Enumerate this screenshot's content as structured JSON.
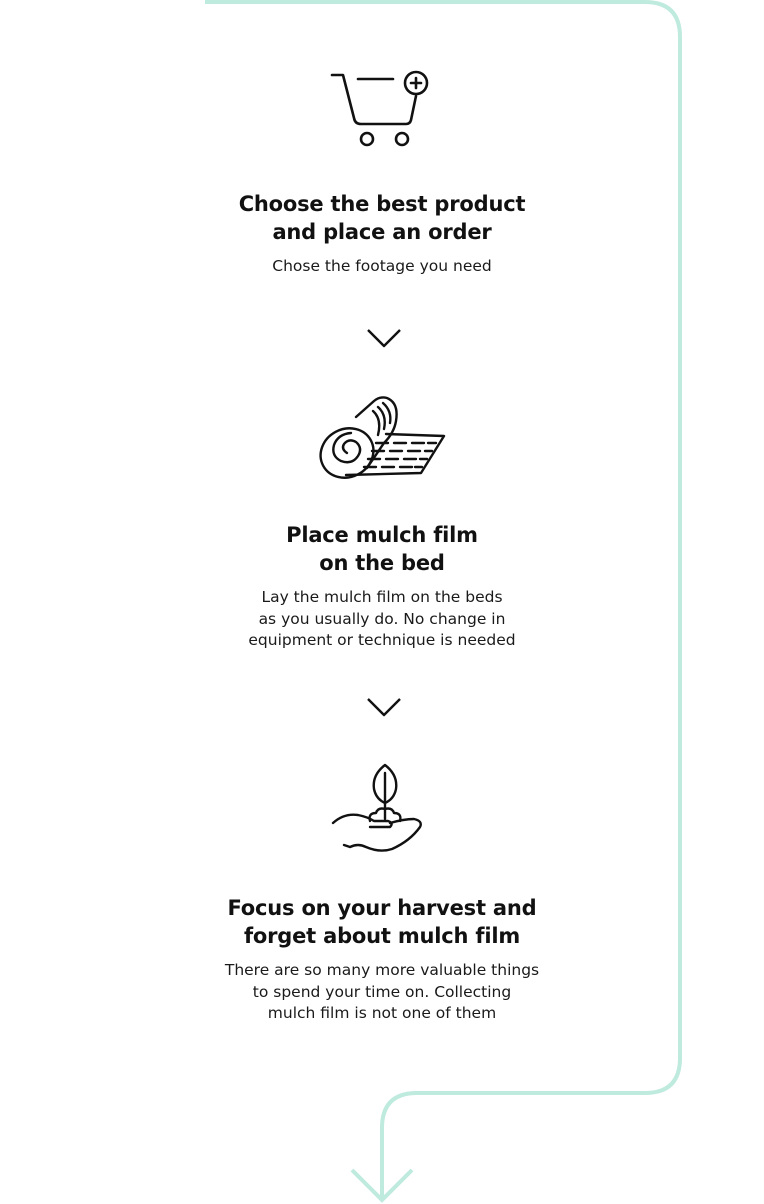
{
  "colors": {
    "flow_line": "#bfeade",
    "icon_stroke": "#111111",
    "text": "#111111"
  },
  "steps": [
    {
      "icon": "cart-plus-icon",
      "title_line1": "Choose the best product",
      "title_line2": "and place an order",
      "desc_line1": "Chose the footage you need"
    },
    {
      "icon": "film-roll-icon",
      "title_line1": "Place mulch film",
      "title_line2": "on the bed",
      "desc_line1": "Lay the mulch film on the beds",
      "desc_line2": "as you usually do. No change in",
      "desc_line3": "equipment or technique is needed"
    },
    {
      "icon": "hand-sprout-icon",
      "title_line1": "Focus on your harvest and",
      "title_line2": "forget about mulch film",
      "desc_line1": "There are so many more valuable things",
      "desc_line2": "to spend your time on. Collecting",
      "desc_line3": "mulch film is not one of them"
    }
  ]
}
